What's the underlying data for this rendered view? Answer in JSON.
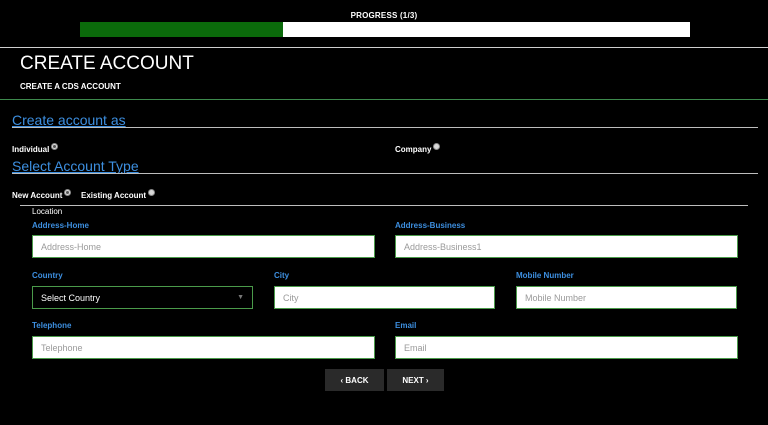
{
  "progress": {
    "label": "PROGRESS (1/3)",
    "fraction": 0.333
  },
  "header": {
    "title": "CREATE ACCOUNT",
    "subtitle": "CREATE A CDS ACCOUNT"
  },
  "create_as": {
    "heading": "Create account as",
    "options": [
      {
        "label": "Individual",
        "checked": true
      },
      {
        "label": "Company",
        "checked": false
      }
    ]
  },
  "account_type": {
    "heading": "Select Account Type",
    "options": [
      {
        "label": "New Account",
        "checked": true
      },
      {
        "label": "Existing Account",
        "checked": false
      }
    ]
  },
  "location": {
    "legend": "Location",
    "address_home": {
      "label": "Address-Home",
      "placeholder": "Address-Home"
    },
    "address_business": {
      "label": "Address-Business",
      "placeholder": "Address-Business1"
    },
    "country": {
      "label": "Country",
      "value": "Select Country"
    },
    "city": {
      "label": "City",
      "placeholder": "City"
    },
    "mobile": {
      "label": "Mobile Number",
      "placeholder": "Mobile Number"
    },
    "telephone": {
      "label": "Telephone",
      "placeholder": "Telephone"
    },
    "email": {
      "label": "Email",
      "placeholder": "Email"
    }
  },
  "buttons": {
    "back": "‹ BACK",
    "next": "NEXT ›"
  },
  "colors": {
    "accent": "#3d8fe0",
    "progress": "#0b6a0b",
    "field_border": "#4a9a4a"
  },
  "icons": {
    "dropdown": "chevron-down-icon"
  }
}
